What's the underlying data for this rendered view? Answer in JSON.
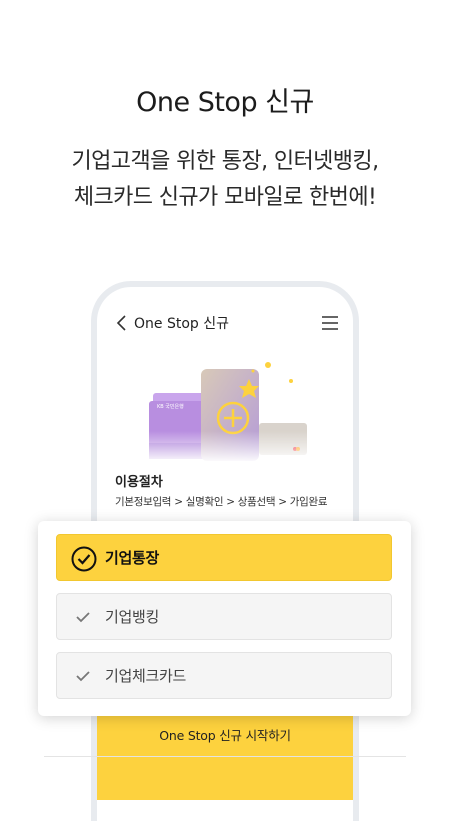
{
  "promo": {
    "headline": "One Stop 신규",
    "sub_line1": "기업고객을 위한 통장, 인터넷뱅킹,",
    "sub_line2": "체크카드 신규가 모바일로 한번에!"
  },
  "app": {
    "title": "One Stop 신규",
    "back_icon": "chevron-left-icon",
    "menu_icon": "hamburger-menu-icon",
    "illustration": {
      "passbook_label": "KB 국민은행",
      "accent_color": "#fdd23e",
      "purple": "#b88ee0"
    },
    "procedure_title": "이용절차",
    "procedure_steps": "기본정보입력 > 실명확인 > 상품선택 > 가입완료"
  },
  "options": [
    {
      "label": "기업통장",
      "selected": true,
      "icon": "check-circle-icon"
    },
    {
      "label": "기업뱅킹",
      "selected": false,
      "icon": "check-icon"
    },
    {
      "label": "기업체크카드",
      "selected": false,
      "icon": "check-icon"
    }
  ],
  "start_button": {
    "label": "One Stop 신규 시작하기"
  },
  "colors": {
    "accent": "#fdd23e",
    "unselected_bg": "#f5f5f5",
    "phone_frame": "#e8ebef"
  }
}
